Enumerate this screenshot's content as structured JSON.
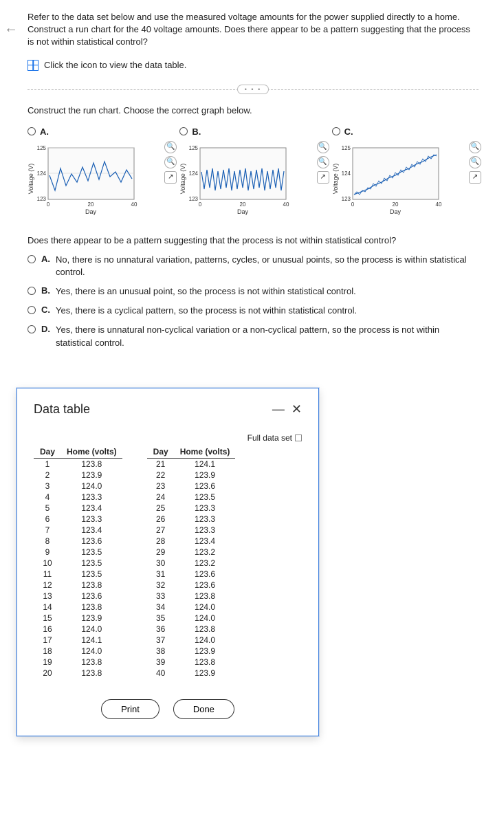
{
  "prompt_text": "Refer to the data set below and use the measured voltage amounts for the power supplied directly to a home. Construct a run chart for the 40 voltage amounts. Does there appear to be a pattern suggesting that the process is not within statistical control?",
  "data_link_text": "Click the icon to view the data table.",
  "expand_label": "• • •",
  "instruction_text": "Construct the run chart. Choose the correct graph below.",
  "chart_options": {
    "a": "A.",
    "b": "B.",
    "c": "C."
  },
  "q2_text": "Does there appear to be a pattern suggesting that the process is not within statistical control?",
  "answers": {
    "a": {
      "label": "A.",
      "text": "No, there is no unnatural variation, patterns, cycles, or unusual points, so the process is within statistical control."
    },
    "b": {
      "label": "B.",
      "text": "Yes, there is an unusual point, so the process is not within statistical control."
    },
    "c": {
      "label": "C.",
      "text": "Yes, there is a cyclical pattern, so the process is not within statistical control."
    },
    "d": {
      "label": "D.",
      "text": "Yes, there is unnatural non-cyclical variation or a non-cyclical pattern, so the process is not within statistical control."
    }
  },
  "modal": {
    "title": "Data table",
    "minimize": "—",
    "close": "✕",
    "full_link": "Full data set",
    "print": "Print",
    "done": "Done",
    "col_day": "Day",
    "col_home": "Home (volts)"
  },
  "chart_axes": {
    "ylabel": "Voltage (V)",
    "xlabel": "Day",
    "yticks": [
      "123",
      "124",
      "125"
    ],
    "xticks": [
      "0",
      "20",
      "40"
    ]
  },
  "chart_data": [
    {
      "type": "line",
      "option": "A",
      "xlabel": "Day",
      "ylabel": "Voltage (V)",
      "xlim": [
        0,
        40
      ],
      "ylim": [
        123,
        125
      ],
      "description": "jagged random-looking line mostly between 123.3 and 124.5 with spikes"
    },
    {
      "type": "line",
      "option": "B",
      "xlabel": "Day",
      "ylabel": "Voltage (V)",
      "xlim": [
        0,
        40
      ],
      "ylim": [
        123,
        125
      ],
      "description": "dense high-frequency oscillation between ~123.2 and ~124.2 across full range"
    },
    {
      "type": "line",
      "option": "C",
      "xlabel": "Day",
      "ylabel": "Voltage (V)",
      "xlim": [
        0,
        40
      ],
      "ylim": [
        123,
        125
      ],
      "description": "generally increasing trend from ~123.2 to ~124.8 with small wiggles"
    }
  ],
  "table_left": [
    {
      "day": "1",
      "v": "123.8"
    },
    {
      "day": "2",
      "v": "123.9"
    },
    {
      "day": "3",
      "v": "124.0"
    },
    {
      "day": "4",
      "v": "123.3"
    },
    {
      "day": "5",
      "v": "123.4"
    },
    {
      "day": "6",
      "v": "123.3"
    },
    {
      "day": "7",
      "v": "123.4"
    },
    {
      "day": "8",
      "v": "123.6"
    },
    {
      "day": "9",
      "v": "123.5"
    },
    {
      "day": "10",
      "v": "123.5"
    },
    {
      "day": "11",
      "v": "123.5"
    },
    {
      "day": "12",
      "v": "123.8"
    },
    {
      "day": "13",
      "v": "123.6"
    },
    {
      "day": "14",
      "v": "123.8"
    },
    {
      "day": "15",
      "v": "123.9"
    },
    {
      "day": "16",
      "v": "124.0"
    },
    {
      "day": "17",
      "v": "124.1"
    },
    {
      "day": "18",
      "v": "124.0"
    },
    {
      "day": "19",
      "v": "123.8"
    },
    {
      "day": "20",
      "v": "123.8"
    }
  ],
  "table_right": [
    {
      "day": "21",
      "v": "124.1"
    },
    {
      "day": "22",
      "v": "123.9"
    },
    {
      "day": "23",
      "v": "123.6"
    },
    {
      "day": "24",
      "v": "123.5"
    },
    {
      "day": "25",
      "v": "123.3"
    },
    {
      "day": "26",
      "v": "123.3"
    },
    {
      "day": "27",
      "v": "123.3"
    },
    {
      "day": "28",
      "v": "123.4"
    },
    {
      "day": "29",
      "v": "123.2"
    },
    {
      "day": "30",
      "v": "123.2"
    },
    {
      "day": "31",
      "v": "123.6"
    },
    {
      "day": "32",
      "v": "123.6"
    },
    {
      "day": "33",
      "v": "123.8"
    },
    {
      "day": "34",
      "v": "124.0"
    },
    {
      "day": "35",
      "v": "124.0"
    },
    {
      "day": "36",
      "v": "123.8"
    },
    {
      "day": "37",
      "v": "124.0"
    },
    {
      "day": "38",
      "v": "123.9"
    },
    {
      "day": "39",
      "v": "123.8"
    },
    {
      "day": "40",
      "v": "123.9"
    }
  ]
}
